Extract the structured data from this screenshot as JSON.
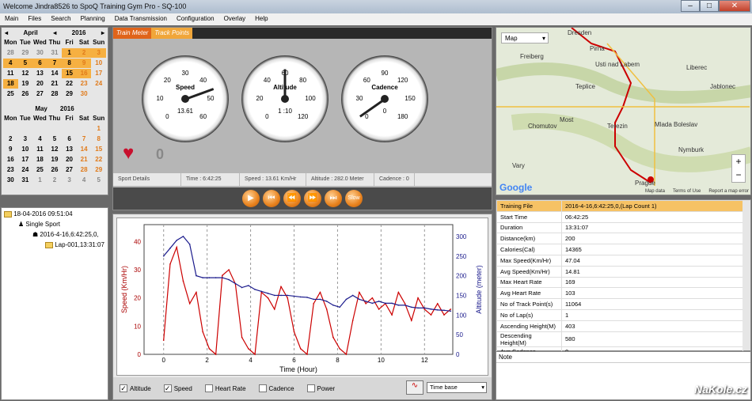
{
  "window": {
    "title": "Welcome Jindra8526 to SpoQ Training Gym Pro - SQ-100",
    "min": "–",
    "max": "□",
    "close": "✕"
  },
  "menu": [
    "Main",
    "Files",
    "Search",
    "Planning",
    "Data Transmission",
    "Configuration",
    "Overlay",
    "Help"
  ],
  "calendar": {
    "april": {
      "month": "April",
      "year": "2016",
      "prev": "◂",
      "next": "▸",
      "days": [
        "Mon",
        "Tue",
        "Wed",
        "Thu",
        "Fri",
        "Sat",
        "Sun"
      ],
      "rows": [
        [
          "28",
          "29",
          "30",
          "31",
          "1",
          "2",
          "3"
        ],
        [
          "4",
          "5",
          "6",
          "7",
          "8",
          "9",
          "10"
        ],
        [
          "11",
          "12",
          "13",
          "14",
          "15",
          "16",
          "17"
        ],
        [
          "18",
          "19",
          "20",
          "21",
          "22",
          "23",
          "24"
        ],
        [
          "25",
          "26",
          "27",
          "28",
          "29",
          "30",
          ""
        ]
      ]
    },
    "may": {
      "month": "May",
      "year": "2016",
      "days": [
        "Mon",
        "Tue",
        "Wed",
        "Thu",
        "Fri",
        "Sat",
        "Sun"
      ],
      "rows": [
        [
          "",
          "",
          "",
          "",
          "",
          "",
          "1"
        ],
        [
          "2",
          "3",
          "4",
          "5",
          "6",
          "7",
          "8"
        ],
        [
          "9",
          "10",
          "11",
          "12",
          "13",
          "14",
          "15"
        ],
        [
          "16",
          "17",
          "18",
          "19",
          "20",
          "21",
          "22"
        ],
        [
          "23",
          "24",
          "25",
          "26",
          "27",
          "28",
          "29"
        ],
        [
          "30",
          "31",
          "1",
          "2",
          "3",
          "4",
          "5"
        ]
      ]
    }
  },
  "tree": {
    "date": "18-04-2016 09:51:04",
    "sport": "Single Sport",
    "session": "2016-4-16,6:42:25,0,",
    "lap": "Lap-001,13:31:07"
  },
  "tabs": {
    "train": "Train Meter",
    "track": "Track Points"
  },
  "gauges": [
    {
      "label": "Speed",
      "value": "13.61",
      "ticks": [
        "0",
        "10",
        "20",
        "30",
        "40",
        "50",
        "60"
      ]
    },
    {
      "label": "Altitude",
      "value": "1 :10",
      "ticks": [
        "0",
        "20",
        "40",
        "60",
        "80",
        "100",
        "120"
      ]
    },
    {
      "label": "Cadence",
      "value": "0",
      "ticks": [
        "0",
        "30",
        "60",
        "90",
        "120",
        "150",
        "180"
      ]
    }
  ],
  "heart_value": "0",
  "sport_details": {
    "label": "Sport Details",
    "time": "Time : 6:42:25",
    "speed": "Speed : 13.61 Km/Hr",
    "altitude": "Altitude : 282.0 Meter",
    "cadence": "Cadence : 0"
  },
  "playbar": {
    "slow": "Slow"
  },
  "chart_data": {
    "type": "line",
    "xlabel": "Time (Hour)",
    "ylabel": "Speed (Km/Hr)",
    "ylabel2": "Altitude (meter)",
    "x_ticks": [
      "0",
      "2",
      "4",
      "6",
      "8",
      "10",
      "12"
    ],
    "y_ticks": [
      "0",
      "10",
      "20",
      "30",
      "40"
    ],
    "y2_ticks": [
      "0",
      "50",
      "100",
      "150",
      "200",
      "250",
      "300"
    ],
    "xlim": [
      -0.9,
      13.3
    ],
    "ylim": [
      0,
      46
    ],
    "y2lim": [
      0,
      330
    ],
    "series": [
      {
        "color": "#cc0000",
        "x": [
          0,
          0.3,
          0.6,
          0.9,
          1.2,
          1.5,
          1.8,
          2.1,
          2.4,
          2.7,
          3.0,
          3.3,
          3.6,
          3.9,
          4.2,
          4.5,
          4.8,
          5.1,
          5.4,
          5.7,
          6.0,
          6.3,
          6.6,
          6.9,
          7.2,
          7.5,
          7.8,
          8.1,
          8.4,
          8.7,
          9.0,
          9.3,
          9.6,
          9.9,
          10.2,
          10.5,
          10.8,
          11.1,
          11.4,
          11.7,
          12.0,
          12.3,
          12.6,
          12.9,
          13.2
        ],
        "y": [
          5,
          32,
          38,
          26,
          18,
          22,
          8,
          2,
          0,
          28,
          30,
          25,
          6,
          2,
          0,
          22,
          20,
          16,
          24,
          20,
          8,
          2,
          0,
          18,
          22,
          16,
          6,
          2,
          0,
          12,
          22,
          18,
          20,
          16,
          18,
          14,
          22,
          18,
          12,
          20,
          16,
          14,
          18,
          14,
          16
        ]
      },
      {
        "color": "#1a1a8c",
        "x": [
          0,
          0.3,
          0.6,
          0.9,
          1.2,
          1.5,
          1.8,
          2.1,
          2.4,
          2.7,
          3.0,
          3.3,
          3.6,
          3.9,
          4.2,
          4.5,
          4.8,
          5.1,
          5.4,
          5.7,
          6.0,
          6.3,
          6.6,
          6.9,
          7.2,
          7.5,
          7.8,
          8.1,
          8.4,
          8.7,
          9.0,
          9.3,
          9.6,
          9.9,
          10.2,
          10.5,
          10.8,
          11.1,
          11.4,
          11.7,
          12.0,
          12.3,
          12.6,
          12.9,
          13.2
        ],
        "y": [
          250,
          270,
          290,
          300,
          280,
          200,
          195,
          195,
          195,
          195,
          190,
          180,
          170,
          175,
          165,
          160,
          155,
          150,
          150,
          150,
          148,
          146,
          145,
          140,
          140,
          135,
          125,
          120,
          140,
          150,
          140,
          135,
          130,
          135,
          130,
          130,
          125,
          125,
          120,
          118,
          118,
          115,
          113,
          112,
          110
        ]
      }
    ]
  },
  "checks": [
    {
      "label": "Altitude",
      "checked": true
    },
    {
      "label": "Speed",
      "checked": true
    },
    {
      "label": "Heart Rate",
      "checked": false
    },
    {
      "label": "Cadence",
      "checked": false
    },
    {
      "label": "Power",
      "checked": false
    }
  ],
  "timebase": "Time base",
  "map": {
    "type": "Map",
    "places": [
      "Dresden",
      "Pirna",
      "Freiberg",
      "Usti nad Labem",
      "Liberec",
      "Teplice",
      "Most",
      "Chomutov",
      "Mlada Boleslav",
      "Terezin",
      "Nymburk",
      "Prague",
      "Vary",
      "Jablonec"
    ],
    "google": "Google",
    "mapdata": "Map data",
    "terms": "Terms of Use",
    "report": "Report a map error",
    "zoomin": "+",
    "zoomout": "−"
  },
  "info": {
    "header": [
      "Training File",
      "2016-4-16,6:42:25,0,(Lap Count 1)"
    ],
    "rows": [
      [
        "Start Time",
        "06:42:25"
      ],
      [
        "Duration",
        "13:31:07"
      ],
      [
        "Distance(km)",
        "200"
      ],
      [
        "Calories(Cal)",
        "14365"
      ],
      [
        "Max Speed(Km/Hr)",
        "47.04"
      ],
      [
        "Avg Speed(Km/Hr)",
        "14.81"
      ],
      [
        "Max Heart Rate",
        "169"
      ],
      [
        "Avg Heart Rate",
        "103"
      ],
      [
        "No of Track Point(s)",
        "11064"
      ],
      [
        "No of Lap(s)",
        "1"
      ],
      [
        "Ascending Height(M)",
        "403"
      ],
      [
        "Descending Height(M)",
        "580"
      ],
      [
        "Avg Cadence",
        "0"
      ]
    ]
  },
  "note": {
    "label": "Note"
  },
  "watermark": "NaKole.cz"
}
